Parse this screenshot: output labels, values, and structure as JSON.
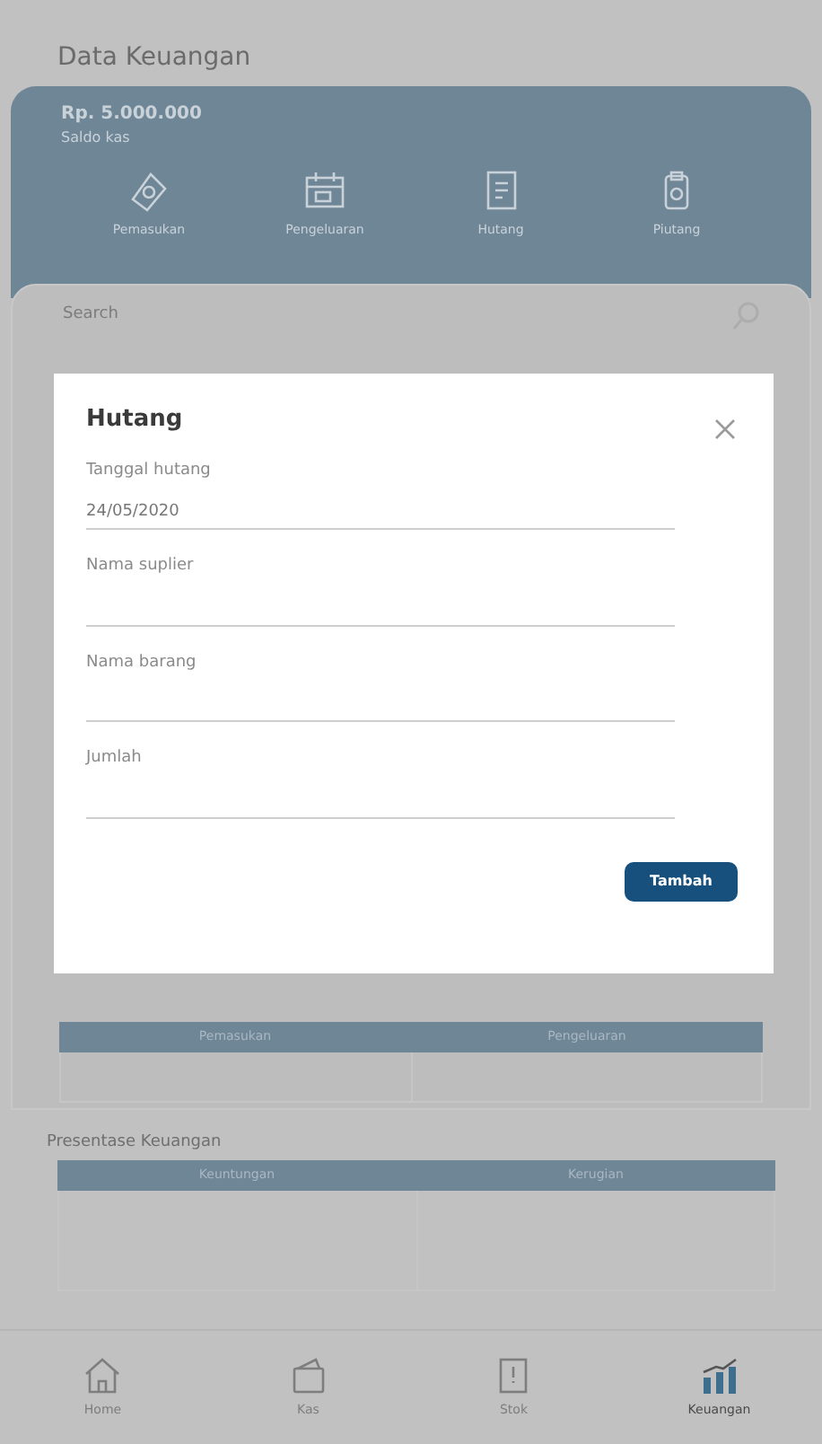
{
  "page_title": "Data Keuangan",
  "balance": {
    "amount": "Rp. 5.000.000",
    "label": "Saldo kas"
  },
  "actions": [
    {
      "label": "Pemasukan"
    },
    {
      "label": "Pengeluaran"
    },
    {
      "label": "Hutang"
    },
    {
      "label": "Piutang"
    }
  ],
  "search": {
    "placeholder": "Search"
  },
  "table_1": {
    "columns": [
      "Pemasukan",
      "Pengeluaran"
    ]
  },
  "section_title": "Presentase Keuangan",
  "table_2": {
    "columns": [
      "Keuntungan",
      "Kerugian"
    ]
  },
  "bottom_nav": [
    {
      "label": "Home",
      "selected": false
    },
    {
      "label": "Kas",
      "selected": false
    },
    {
      "label": "Stok",
      "selected": false
    },
    {
      "label": "Keuangan",
      "selected": true
    }
  ],
  "dialog": {
    "title": "Hutang",
    "fields": [
      {
        "label": "Tanggal hutang",
        "value": "24/05/2020"
      },
      {
        "label": "Nama suplier"
      },
      {
        "label": "Nama barang"
      },
      {
        "label": "Jumlah"
      }
    ],
    "submit": "Tambah"
  }
}
